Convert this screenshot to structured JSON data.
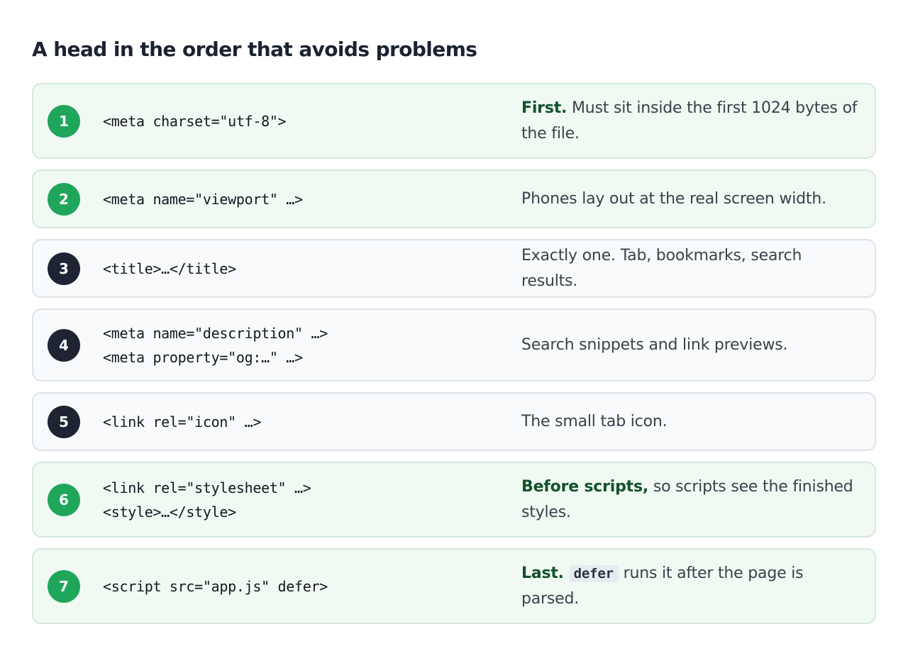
{
  "title": "A head in the order that avoids problems",
  "steps": [
    {
      "number": "1",
      "code": [
        "<meta charset=\"utf-8\">"
      ],
      "note_strong": "First.",
      "note_text": " Must sit inside the first 1024 bytes of the file."
    },
    {
      "number": "2",
      "code": [
        "<meta name=\"viewport\" …>"
      ],
      "note_text": "Phones lay out at the real screen width."
    },
    {
      "number": "3",
      "code": [
        "<title>…</title>"
      ],
      "note_text": "Exactly one. Tab, bookmarks, search results."
    },
    {
      "number": "4",
      "code": [
        "<meta name=\"description\" …>",
        "<meta property=\"og:…\" …>"
      ],
      "note_text": "Search snippets and link previews."
    },
    {
      "number": "5",
      "code": [
        "<link rel=\"icon\" …>"
      ],
      "note_text": "The small tab icon."
    },
    {
      "number": "6",
      "code": [
        "<link rel=\"stylesheet\" …>",
        "<style>…</style>"
      ],
      "note_strong": "Before scripts,",
      "note_text": " so scripts see the finished styles."
    },
    {
      "number": "7",
      "code": [
        "<script src=\"app.js\" defer>"
      ],
      "note_strong": "Last.",
      "note_code": "defer",
      "note_text": " runs it after the page is parsed."
    }
  ],
  "colors": {
    "highlight_badge": "#1fa65a",
    "default_badge": "#1e2433",
    "highlight_row_bg": "#f0f9f2",
    "default_row_bg": "#f8fafc",
    "strong_text": "#15522c"
  }
}
